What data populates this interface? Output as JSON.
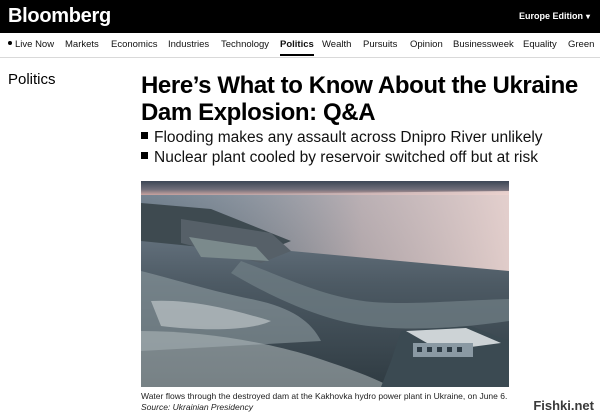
{
  "header": {
    "logo": "Bloomberg",
    "edition": "Europe Edition",
    "edition_chevron": "▾"
  },
  "nav": [
    {
      "label": "Live Now",
      "active": false,
      "live": true
    },
    {
      "label": "Markets",
      "active": false
    },
    {
      "label": "Economics",
      "active": false
    },
    {
      "label": "Industries",
      "active": false
    },
    {
      "label": "Technology",
      "active": false
    },
    {
      "label": "Politics",
      "active": true
    },
    {
      "label": "Wealth",
      "active": false
    },
    {
      "label": "Pursuits",
      "active": false
    },
    {
      "label": "Opinion",
      "active": false
    },
    {
      "label": "Businessweek",
      "active": false
    },
    {
      "label": "Equality",
      "active": false
    },
    {
      "label": "Green",
      "active": false
    }
  ],
  "article": {
    "section": "Politics",
    "headline": "Here’s What to Know About the Ukraine Dam Explosion: Q&A",
    "bullets": [
      "Flooding makes any assault across Dnipro River unlikely",
      "Nuclear plant cooled by reservoir switched off but at risk"
    ],
    "caption_text": "Water flows through the destroyed dam at the Kakhovka hydro power plant in Ukraine, on June 6.",
    "caption_source": "Source: Ukrainian Presidency"
  },
  "watermark": "Fishki.net",
  "colors": {
    "topbar": "#000000",
    "active_underline": "#000000"
  }
}
